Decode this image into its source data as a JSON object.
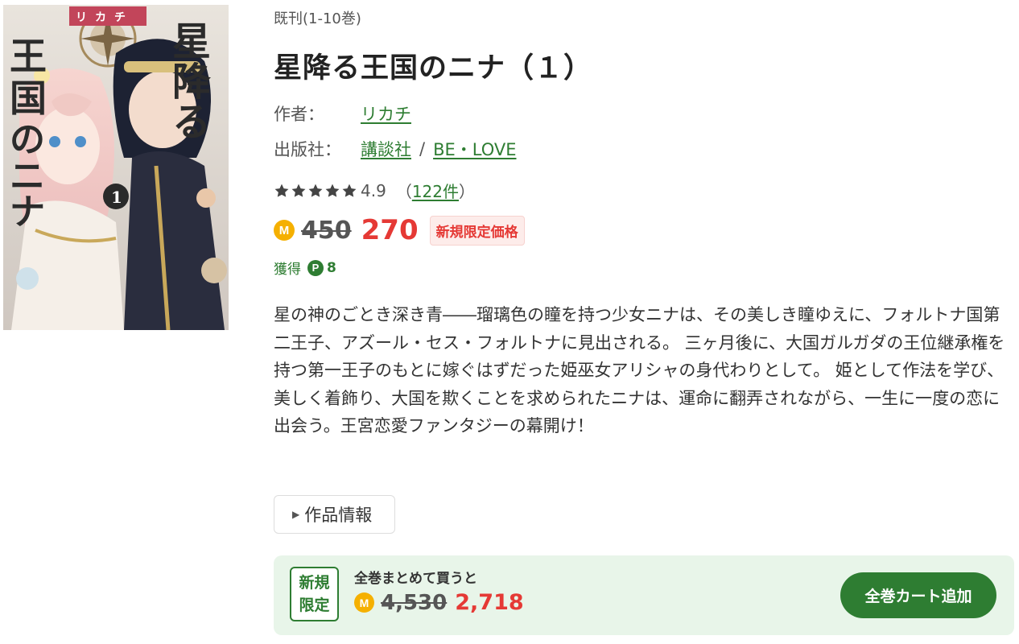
{
  "cover": {
    "alt_title_lines": [
      "星",
      "降",
      "る",
      "王",
      "国",
      "の",
      "ニ",
      "ナ"
    ],
    "author_tag": "リカチ",
    "volume": "1"
  },
  "book": {
    "status": "既刊(1-10巻)",
    "title": "星降る王国のニナ（１）",
    "author_label": "作者：",
    "author": "リカチ",
    "publisher_label": "出版社：",
    "publisher": "講談社",
    "separator": "/",
    "label": "BE・LOVE"
  },
  "rating": {
    "stars": 5,
    "value": "4.9",
    "count_open": "（",
    "count": "122件",
    "count_close": "）"
  },
  "price": {
    "coin_icon": "M",
    "original": "450",
    "current": "270",
    "badge": "新規限定価格"
  },
  "points": {
    "label": "獲得",
    "icon": "P",
    "value": "8"
  },
  "description": "星の神のごとき深き青――瑠璃色の瞳を持つ少女ニナは、その美しき瞳ゆえに、フォルトナ国第二王子、アズール・セス・フォルトナに見出される。 三ヶ月後に、大国ガルガダの王位継承権を持つ第一王子のもとに嫁ぐはずだった姫巫女アリシャの身代わりとして。 姫として作法を学び、美しく着飾り、大国を欺くことを求められたニナは、運命に翻弄されながら、一生に一度の恋に出会う。王宮恋愛ファンタジーの幕開け！",
  "work_info_button": "作品情報",
  "bundle": {
    "badge_line1": "新規",
    "badge_line2": "限定",
    "text": "全巻まとめて買うと",
    "coin_icon": "M",
    "original": "4,530",
    "current": "2,718",
    "cart_button": "全巻カート追加"
  },
  "colors": {
    "accent_green": "#2e7d32",
    "sale_red": "#e53935",
    "coin_yellow": "#f5b000",
    "bundle_bg": "#e8f5e9"
  }
}
